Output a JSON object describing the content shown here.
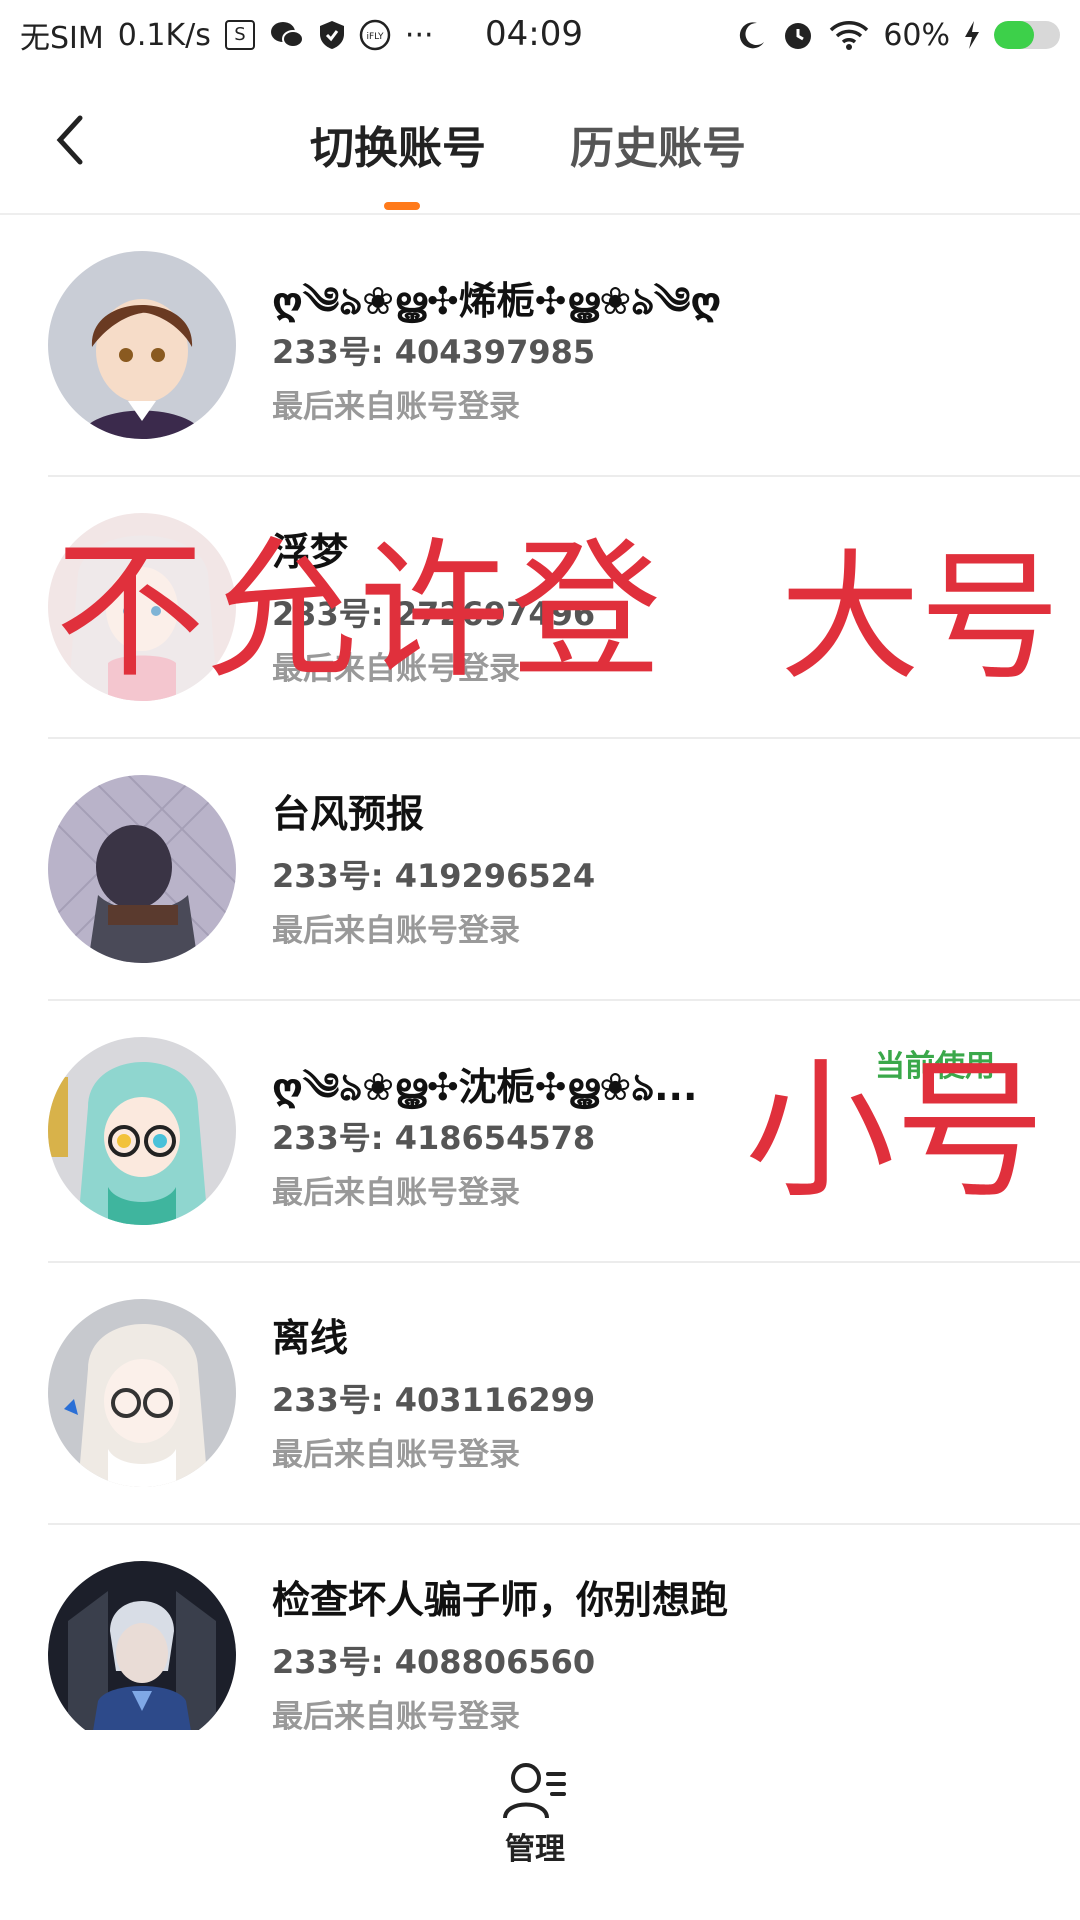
{
  "status_bar": {
    "carrier": "无SIM",
    "speed": "0.1K/s",
    "box_label": "S",
    "time": "04:09",
    "battery": "60%",
    "battery_level": 0.6
  },
  "header": {
    "tab_active": "切换账号",
    "tab_inactive": "历史账号"
  },
  "accounts": [
    {
      "name": "ღ༄ঌ❀ൠ✣烯栀✣ൠ❀ঌ༄ღ",
      "uid": "233号: 404397985",
      "login": "最后来自账号登录"
    },
    {
      "name": "浮梦",
      "uid": "233号: 272697496",
      "login": "最后来自账号登录"
    },
    {
      "name": "台风预报",
      "uid": "233号: 419296524",
      "login": "最后来自账号登录"
    },
    {
      "name": "ღ༄ঌ❀ൠ✣沈栀✣ൠ❀ঌ...",
      "uid": "233号: 418654578",
      "login": "最后来自账号登录",
      "badge": "当前使用"
    },
    {
      "name": "离线",
      "uid": "233号: 403116299",
      "login": "最后来自账号登录"
    },
    {
      "name": "检查坏人骗子师，你别想跑",
      "uid": "233号: 408806560",
      "login": "最后来自账号登录"
    }
  ],
  "overlays": {
    "text1": "不允许登",
    "text2": "大号",
    "text3": "小号"
  },
  "bottom_nav": {
    "manage_label": "管理"
  },
  "colors": {
    "accent": "#ff7a1a",
    "overlay_red": "#e0303c",
    "current_green": "#3aa84a"
  }
}
